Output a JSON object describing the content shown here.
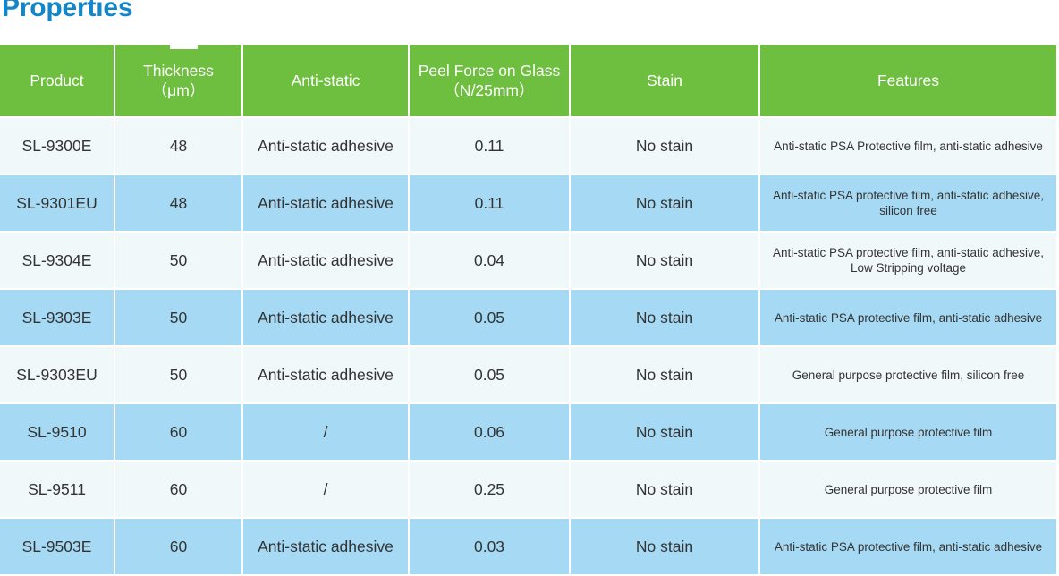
{
  "page": {
    "title": "Properties",
    "title_color": "#1385c9",
    "background": "#ffffff"
  },
  "theme": {
    "header_green": "#6ebe3f",
    "row_blue": "#a6daf4",
    "row_light": "#f1f8fa",
    "header_text": "#ffffff",
    "body_text": "#333333",
    "grid_line": "#ffffff"
  },
  "table": {
    "columns": [
      {
        "key": "product",
        "label": "Product"
      },
      {
        "key": "thickness",
        "label": "Thickness\n（μm）",
        "line1": "Thickness",
        "line2": "（μm）"
      },
      {
        "key": "antistatic",
        "label": "Anti-static"
      },
      {
        "key": "peel",
        "label": "Peel Force on Glass\n（N/25mm）",
        "line1": "Peel Force on Glass",
        "line2": "（N/25mm）"
      },
      {
        "key": "stain",
        "label": "Stain"
      },
      {
        "key": "features",
        "label": "Features"
      }
    ],
    "rows": [
      {
        "product": "SL-9300E",
        "thickness": "48",
        "antistatic": "Anti-static adhesive",
        "peel": "0.11",
        "stain": "No stain",
        "features": "Anti-static PSA Protective film, anti-static adhesive",
        "shade": "light"
      },
      {
        "product": "SL-9301EU",
        "thickness": "48",
        "antistatic": "Anti-static adhesive",
        "peel": "0.11",
        "stain": "No stain",
        "features": "Anti-static PSA protective film, anti-static adhesive,  silicon free",
        "shade": "blue"
      },
      {
        "product": "SL-9304E",
        "thickness": "50",
        "antistatic": "Anti-static adhesive",
        "peel": "0.04",
        "stain": "No stain",
        "features": "Anti-static PSA protective film, anti-static adhesive, Low Stripping voltage",
        "shade": "light"
      },
      {
        "product": "SL-9303E",
        "thickness": "50",
        "antistatic": "Anti-static adhesive",
        "peel": "0.05",
        "stain": "No stain",
        "features": "Anti-static PSA protective film, anti-static adhesive",
        "shade": "blue"
      },
      {
        "product": "SL-9303EU",
        "thickness": "50",
        "antistatic": "Anti-static adhesive",
        "peel": "0.05",
        "stain": "No stain",
        "features": "General purpose protective film, silicon free",
        "shade": "light"
      },
      {
        "product": "SL-9510",
        "thickness": "60",
        "antistatic": "/",
        "peel": "0.06",
        "stain": "No stain",
        "features": "General purpose protective film",
        "shade": "blue"
      },
      {
        "product": "SL-9511",
        "thickness": "60",
        "antistatic": "/",
        "peel": "0.25",
        "stain": "No stain",
        "features": "General purpose protective film",
        "shade": "light"
      },
      {
        "product": "SL-9503E",
        "thickness": "60",
        "antistatic": "Anti-static adhesive",
        "peel": "0.03",
        "stain": "No stain",
        "features": "Anti-static PSA protective film, anti-static adhesive",
        "shade": "blue"
      }
    ]
  }
}
